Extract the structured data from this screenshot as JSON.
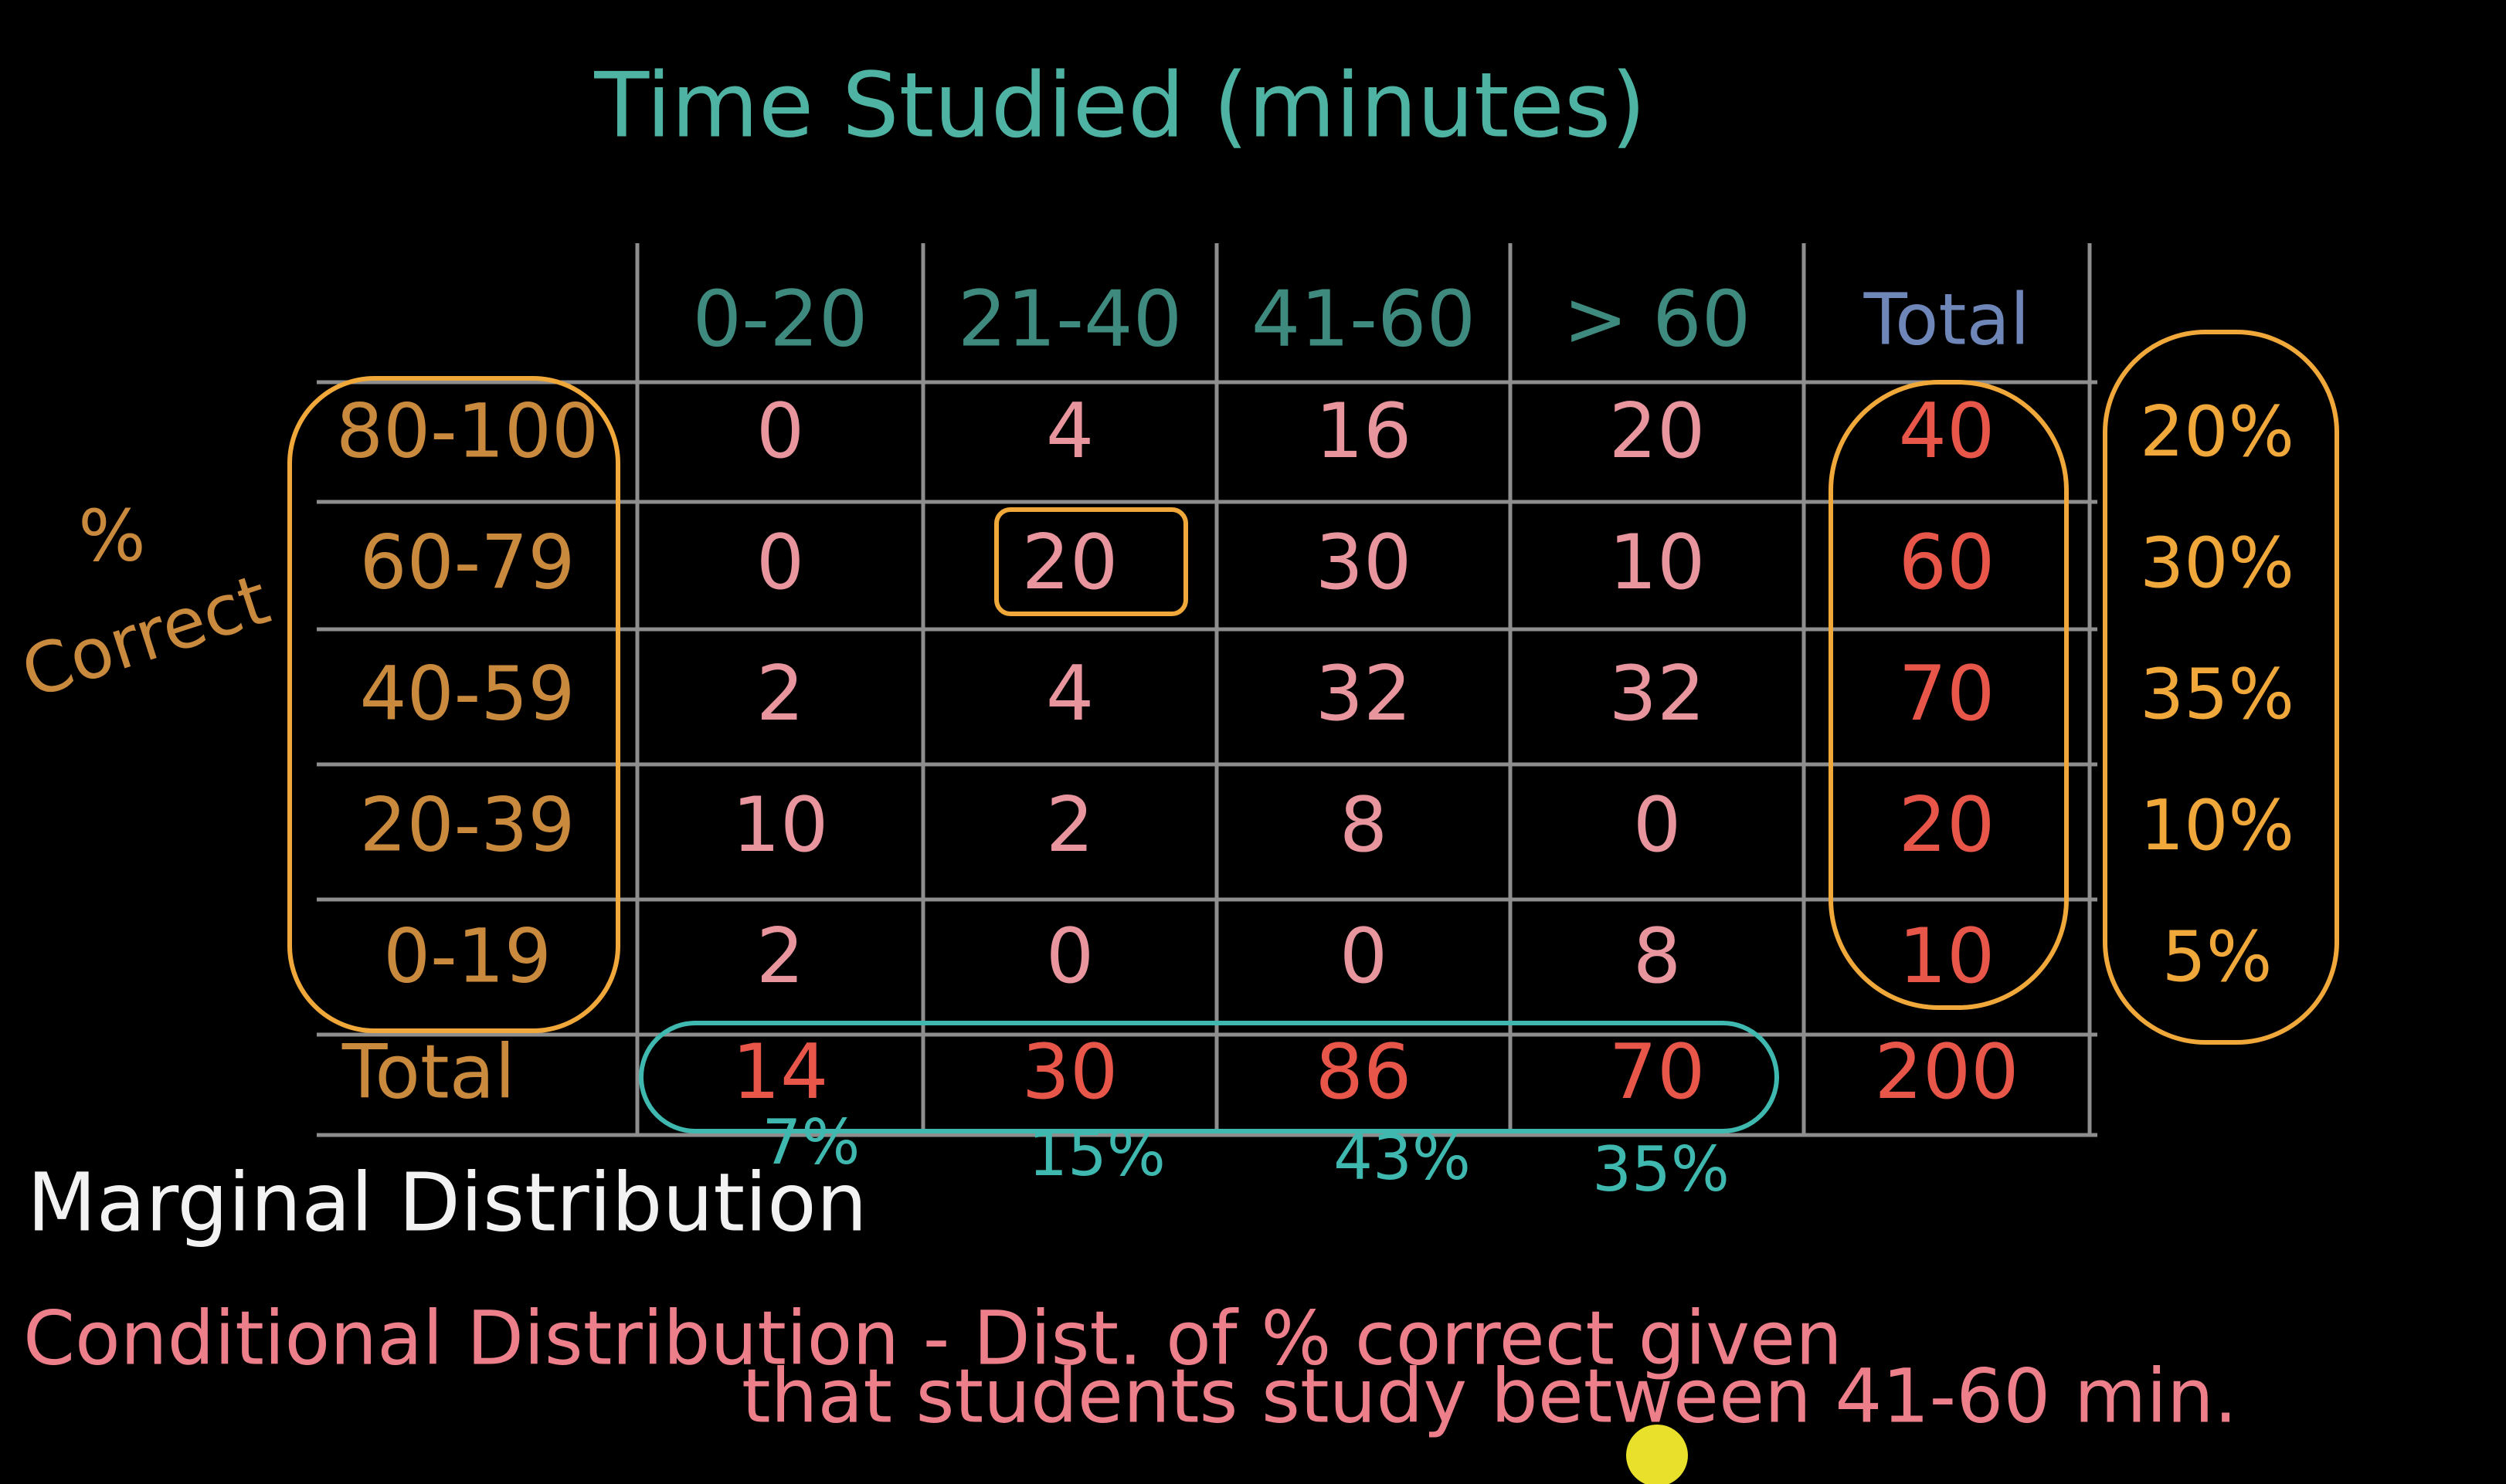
{
  "title": "Time Studied (minutes)",
  "row_axis_label": [
    "%",
    "Correct"
  ],
  "column_headers": [
    "0-20",
    "21-40",
    "41-60",
    "> 60",
    "Total"
  ],
  "rows": [
    {
      "label": "80-100",
      "values": [
        "0",
        "4",
        "16",
        "20"
      ],
      "total": "40",
      "percent": "20%"
    },
    {
      "label": "60-79",
      "values": [
        "0",
        "20",
        "30",
        "10"
      ],
      "total": "60",
      "percent": "30%"
    },
    {
      "label": "40-59",
      "values": [
        "2",
        "4",
        "32",
        "32"
      ],
      "total": "70",
      "percent": "35%"
    },
    {
      "label": "20-39",
      "values": [
        "10",
        "2",
        "8",
        "0"
      ],
      "total": "20",
      "percent": "10%"
    },
    {
      "label": "0-19",
      "values": [
        "2",
        "0",
        "0",
        "8"
      ],
      "total": "10",
      "percent": "5%"
    }
  ],
  "total_row": {
    "label": "Total",
    "values": [
      "14",
      "30",
      "86",
      "70"
    ],
    "grand_total": "200"
  },
  "column_percents": [
    "7%",
    "15%",
    "43%",
    "35%"
  ],
  "notes": {
    "marginal": "Marginal Distribution",
    "conditional_line1": "Conditional Distribution - Dist. of % correct given",
    "conditional_line2": "that students study between 41-60 min."
  },
  "colors": {
    "title": "#4fb3a3",
    "header": "#3f8a7e",
    "total_header": "#6f86b8",
    "row_label": "#c98a3e",
    "cell": "#e8959e",
    "total_col": "#e8564a",
    "circle": "#f0a83a",
    "teal_oval": "#3fb8b0",
    "marginal_note": "#f2f2f2",
    "conditional_note": "#ec7f8a",
    "cursor": "#e8e02a",
    "grid": "#8e8e8e"
  }
}
